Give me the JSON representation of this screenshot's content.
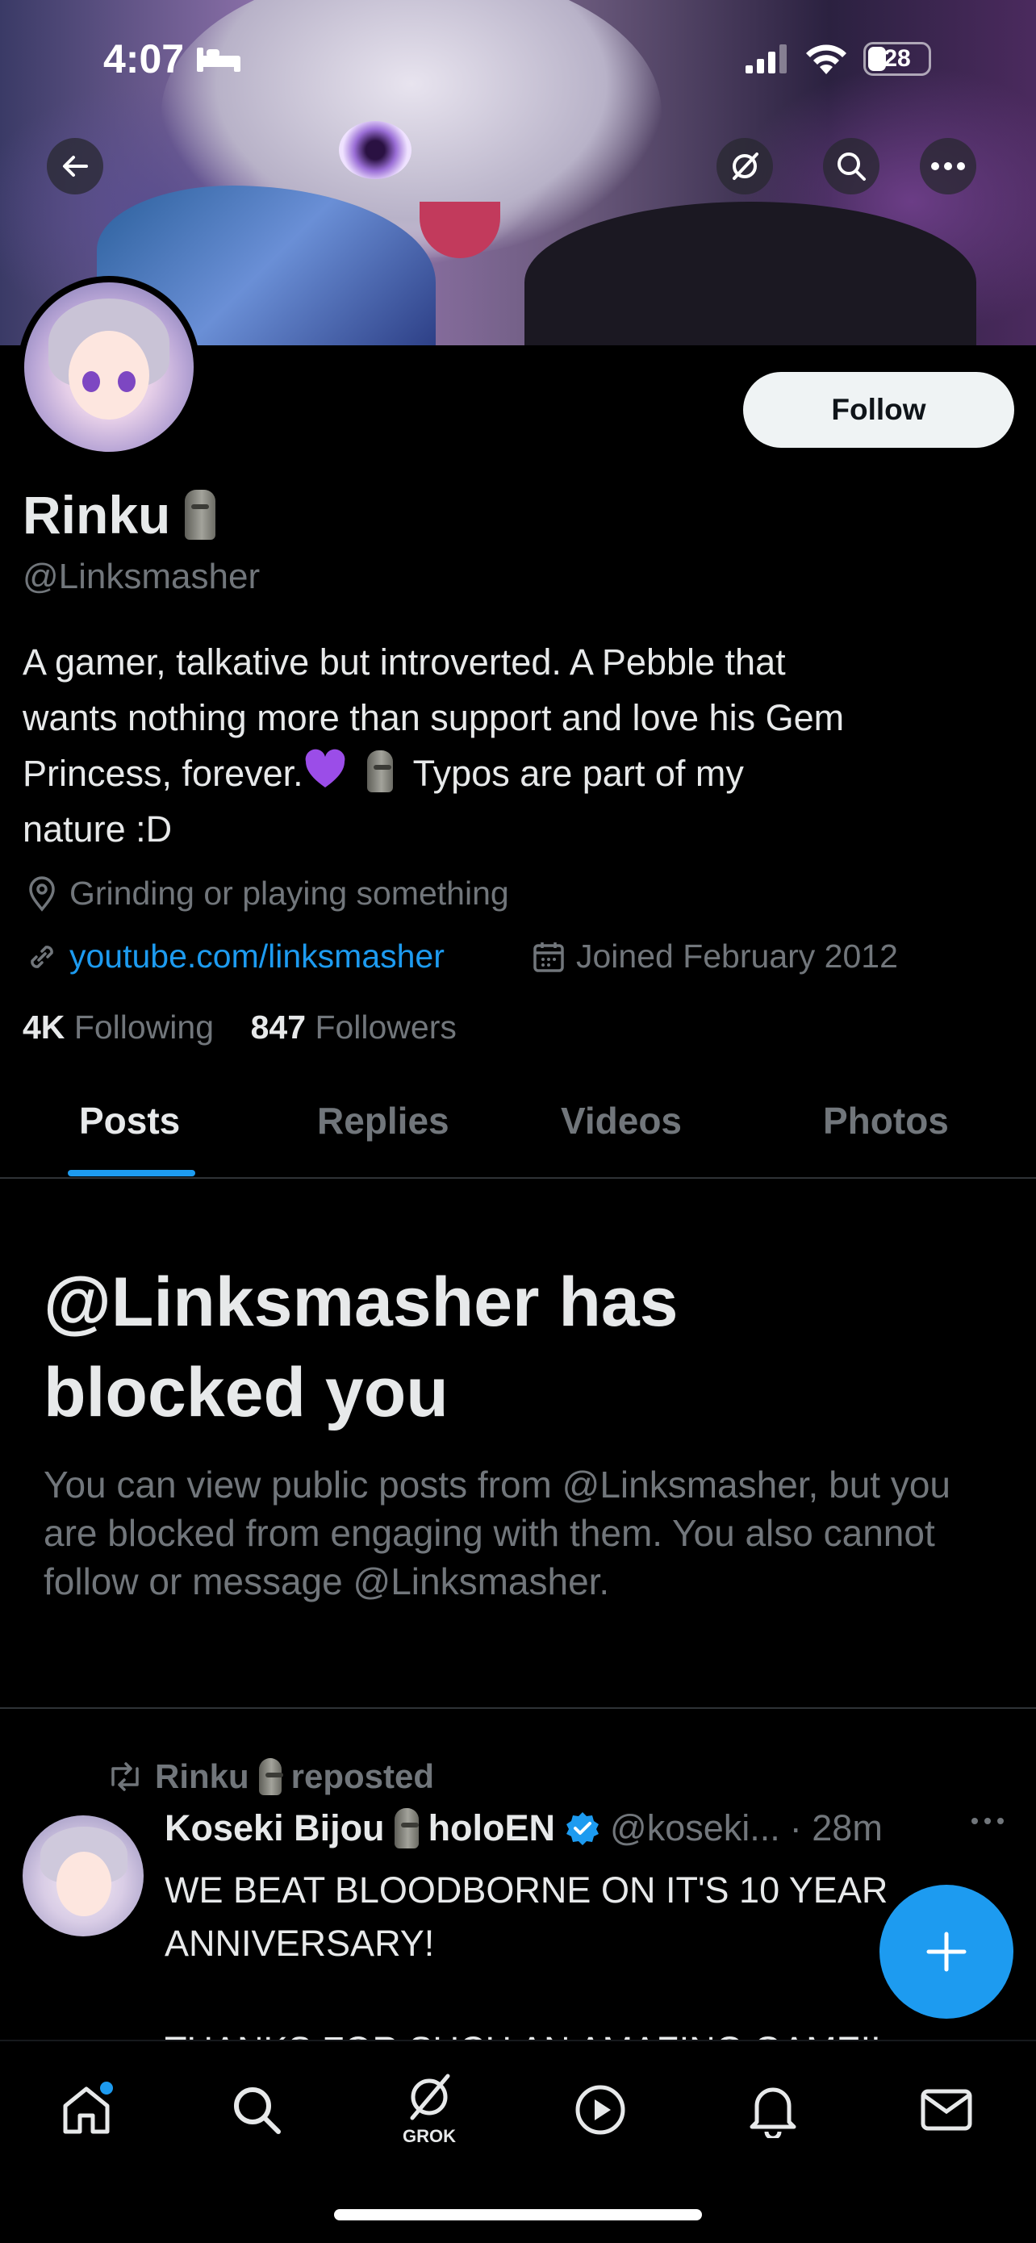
{
  "status_bar": {
    "time": "4:07",
    "battery": "28"
  },
  "profile": {
    "name": "Rinku",
    "handle": "@Linksmasher",
    "follow_label": "Follow",
    "bio_line1": "A gamer, talkative but introverted. A Pebble that",
    "bio_line2": "wants nothing more than support and love his Gem",
    "bio_line3a": "Princess, forever.",
    "bio_line3b": "Typos are part of my",
    "bio_line4": "nature :D",
    "location": "Grinding or playing something",
    "website": "youtube.com/linksmasher",
    "joined": "Joined February 2012",
    "following_count": "4K",
    "following_label": "Following",
    "followers_count": "847",
    "followers_label": "Followers"
  },
  "tabs": [
    {
      "label": "Posts"
    },
    {
      "label": "Replies"
    },
    {
      "label": "Videos"
    },
    {
      "label": "Photos"
    }
  ],
  "blocked": {
    "title_line1": "@Linksmasher has",
    "title_line2": "blocked you",
    "description": "You can view public posts from @Linksmasher, but you are blocked from engaging with them. You also cannot follow or message @Linksmasher."
  },
  "post": {
    "reposter": "Rinku",
    "repost_label": "reposted",
    "author_name": "Koseki Bijou",
    "author_suffix": "holoEN",
    "author_handle": "@koseki...",
    "time": "· 28m",
    "text_line1": "WE BEAT BLOODBORNE ON IT'S 10 YEAR",
    "text_line2": "ANNIVERSARY!",
    "text_line3": "THANKS FOR SUCH AN AMAZING GAME!!"
  },
  "nav": {
    "grok_label": "GROK"
  },
  "colors": {
    "accent": "#1d9bf0",
    "background": "#000000",
    "muted": "#71767b",
    "text": "#e7e9ea",
    "verified": "#1d9bf0",
    "heart": "#9b4de8"
  }
}
